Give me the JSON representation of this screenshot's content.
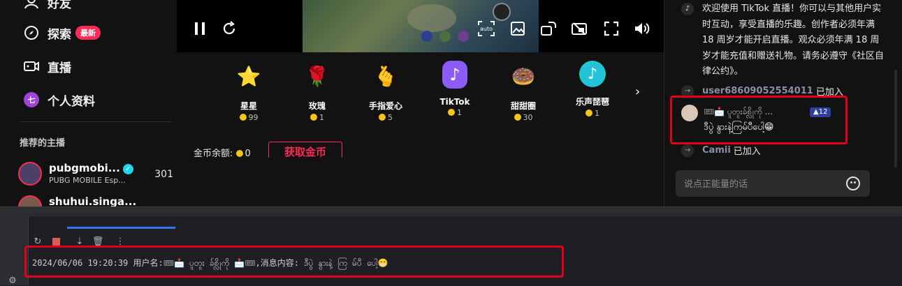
{
  "sidebar": {
    "items": [
      {
        "label": "好友",
        "icon": "friends-icon"
      },
      {
        "label": "探索",
        "icon": "compass-icon",
        "badge": "最新"
      },
      {
        "label": "直播",
        "icon": "live-icon"
      },
      {
        "label": "个人资料",
        "icon": "profile-avatar",
        "avatar_letter": "七"
      }
    ],
    "section_title": "推荐的主播",
    "streamers": [
      {
        "name": "pubgmobi...",
        "sub": "PUBG MOBILE Esp...",
        "count": "301"
      },
      {
        "name": "shuhui.singa..."
      }
    ]
  },
  "player": {
    "controls": [
      "pause-icon",
      "refresh-icon",
      "auto-quality-icon",
      "picture-icon",
      "rotate-icon",
      "pip-icon",
      "fullscreen-icon",
      "volume-icon"
    ],
    "auto_label": "auto"
  },
  "gifts": [
    {
      "name": "星星",
      "price": "99",
      "emoji": "⭐",
      "bg": "#f6c21c"
    },
    {
      "name": "玫瑰",
      "price": "1",
      "emoji": "🌹",
      "bg": "#121212"
    },
    {
      "name": "手指爱心",
      "price": "5",
      "emoji": "🫰",
      "bg": "#121212"
    },
    {
      "name": "TikTok",
      "price": "1",
      "emoji": "♪",
      "bg": "#8b5cf6"
    },
    {
      "name": "甜甜圈",
      "price": "30",
      "emoji": "🍩",
      "bg": "#f5a3c7"
    },
    {
      "name": "乐声琵琶",
      "price": "1",
      "emoji": "♪",
      "bg": "#22c5d6"
    }
  ],
  "wallet": {
    "balance_label": "金币余额:",
    "balance": "0",
    "get_coins": "获取金币"
  },
  "chat": {
    "welcome": "欢迎使用 TikTok 直播！你可以与其他用户实时互动，享受直播的乐趣。创作者必须年满 18 周岁才能开启直播。观众必须年满 18 周岁才能充值和赠送礼物。请务必遵守《社区自律公约》。",
    "joins": [
      {
        "user": "user68609052554011",
        "action": "已加入"
      },
      {
        "user": "Camii",
        "action": "已加入"
      }
    ],
    "message": {
      "name": "🎟📩 ပူတူးခ်စ္လိုကို ...",
      "level": "12",
      "text": "ဒီပွဲ နွားနဲ့ကြမ်ပီပေါ့😁"
    },
    "input_placeholder": "说点正能量的话"
  },
  "console": {
    "line": "2024/06/06 19:20:39 用户名:🎟📩 ပူတူး  ခ်စ္လိုကို    📩🎟,消息内容: ဒီပွဲ  နွားနဲ့ ကြ မ်ပီ ပေါ့😁"
  },
  "colors": {
    "accent": "#fe2c55",
    "highlight": "#e3001b",
    "ide_accent": "#3574f0"
  }
}
